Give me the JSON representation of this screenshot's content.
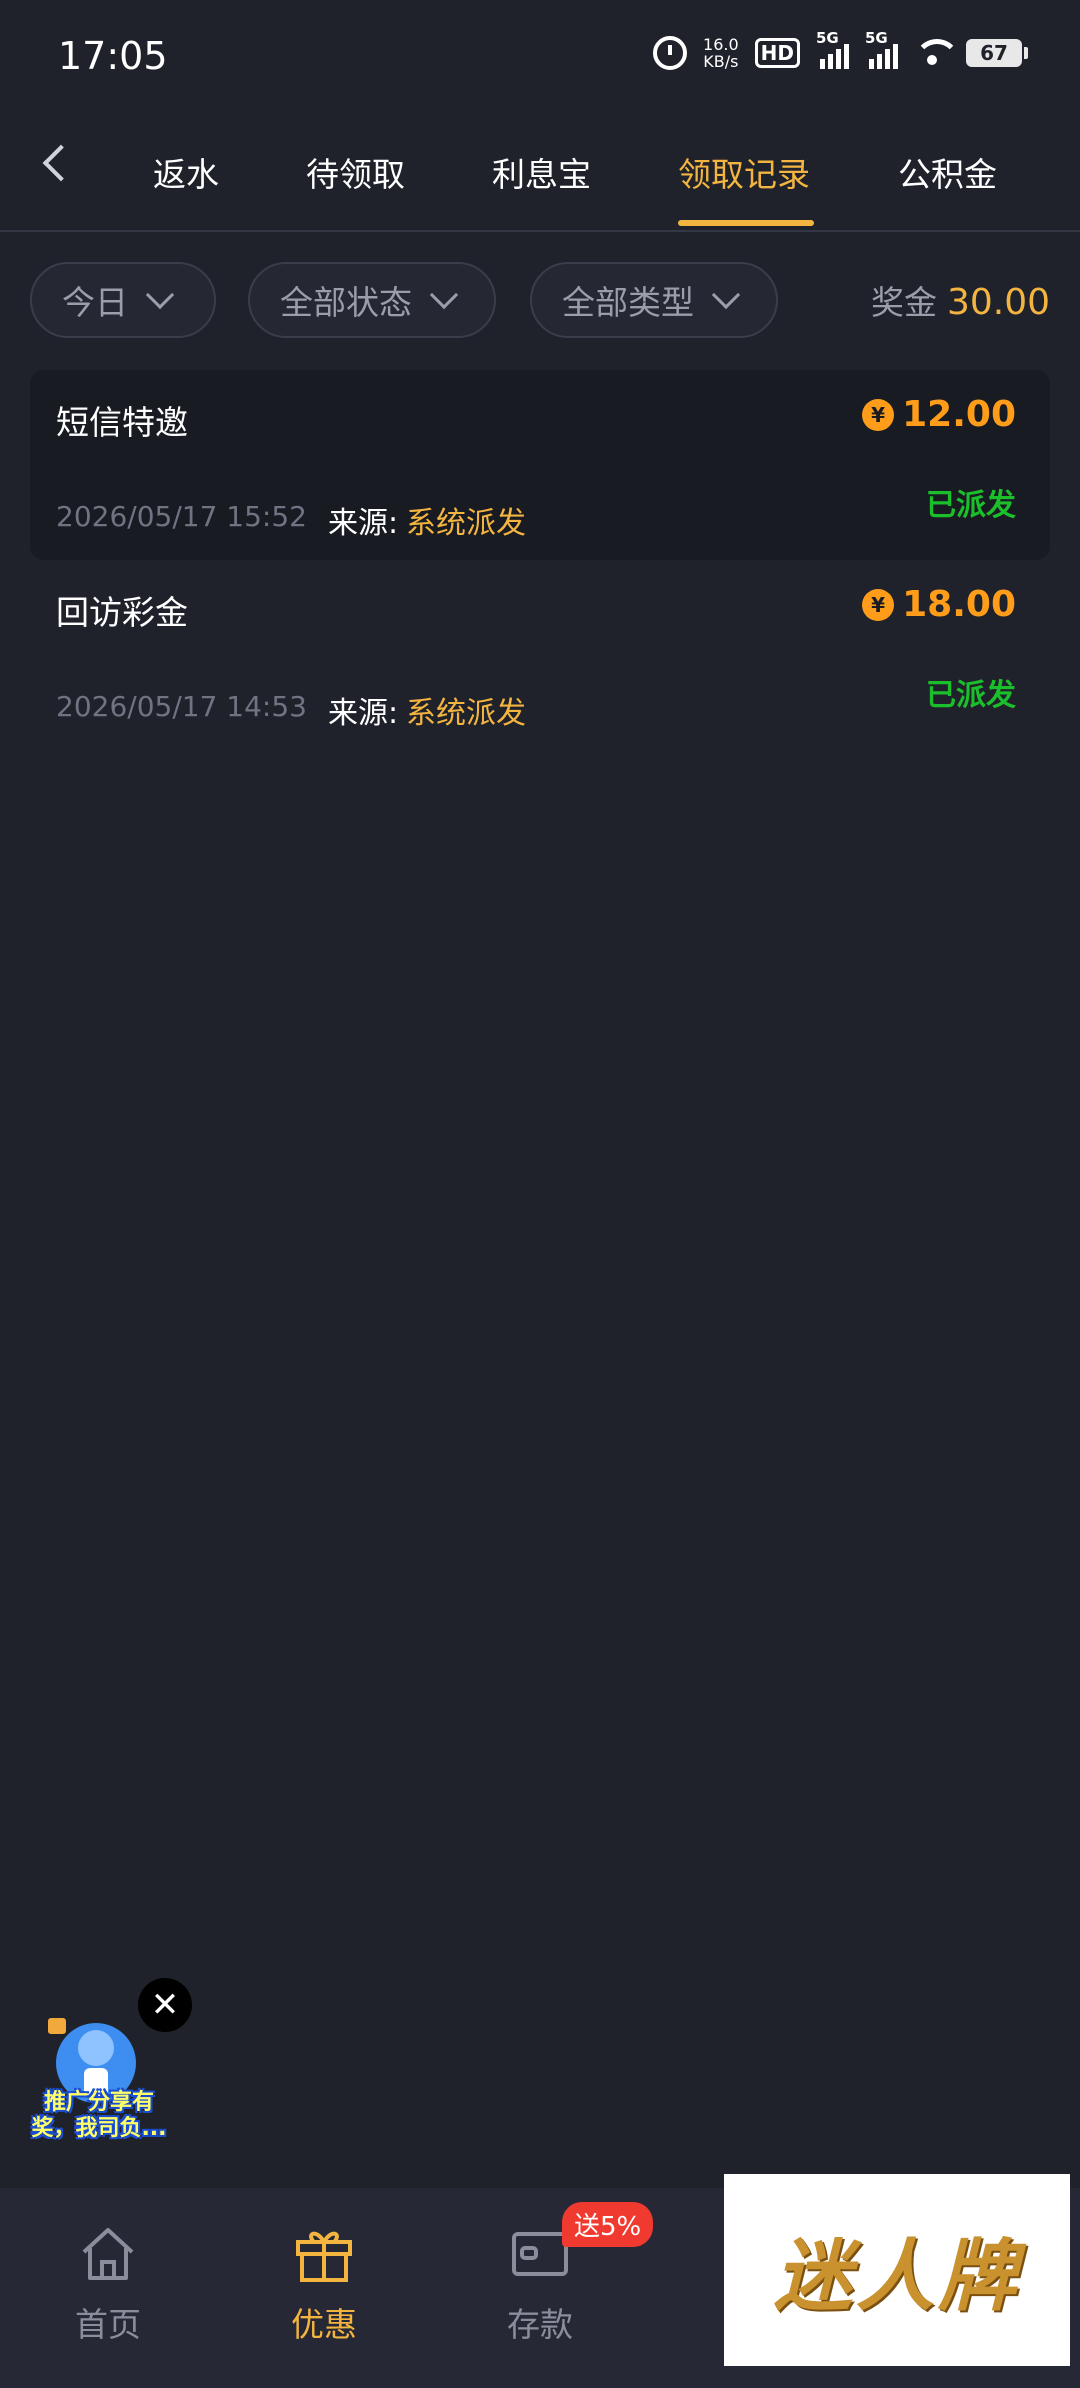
{
  "status_bar": {
    "time": "17:05",
    "net_speed_value": "16.0",
    "net_speed_unit": "KB/s",
    "hd_label": "HD",
    "signal1_label": "5G",
    "signal2_label": "5G",
    "battery": "67"
  },
  "tabs": [
    {
      "label": "返水",
      "active": false
    },
    {
      "label": "待领取",
      "active": false
    },
    {
      "label": "利息宝",
      "active": false
    },
    {
      "label": "领取记录",
      "active": true
    },
    {
      "label": "公积金",
      "active": false
    }
  ],
  "filters": {
    "date": "今日",
    "status": "全部状态",
    "type": "全部类型"
  },
  "bonus": {
    "label": "奖金",
    "value": "30.00"
  },
  "records": [
    {
      "title": "短信特邀",
      "amount": "12.00",
      "currency_symbol": "¥",
      "time": "2026/05/17 15:52",
      "source_label": "来源:",
      "source": "系统派发",
      "status": "已派发"
    },
    {
      "title": "回访彩金",
      "amount": "18.00",
      "currency_symbol": "¥",
      "time": "2026/05/17 14:53",
      "source_label": "来源:",
      "source": "系统派发",
      "status": "已派发"
    }
  ],
  "promo": {
    "line1": "推广分享有",
    "line2": "奖，我司负...",
    "close": "✕"
  },
  "bottom_nav": {
    "items": [
      {
        "label": "首页",
        "icon": "home-icon",
        "active": false
      },
      {
        "label": "优惠",
        "icon": "gift-icon",
        "active": true
      },
      {
        "label": "存款",
        "icon": "wallet-icon",
        "active": false
      }
    ],
    "deposit_badge": "送5%"
  },
  "watermark": {
    "text": "迷人牌"
  },
  "colors": {
    "background": "#1f222b",
    "accent": "#f3b440",
    "amount": "#ff9d1a",
    "success": "#1bbf2b",
    "badge": "#f13a2f"
  }
}
